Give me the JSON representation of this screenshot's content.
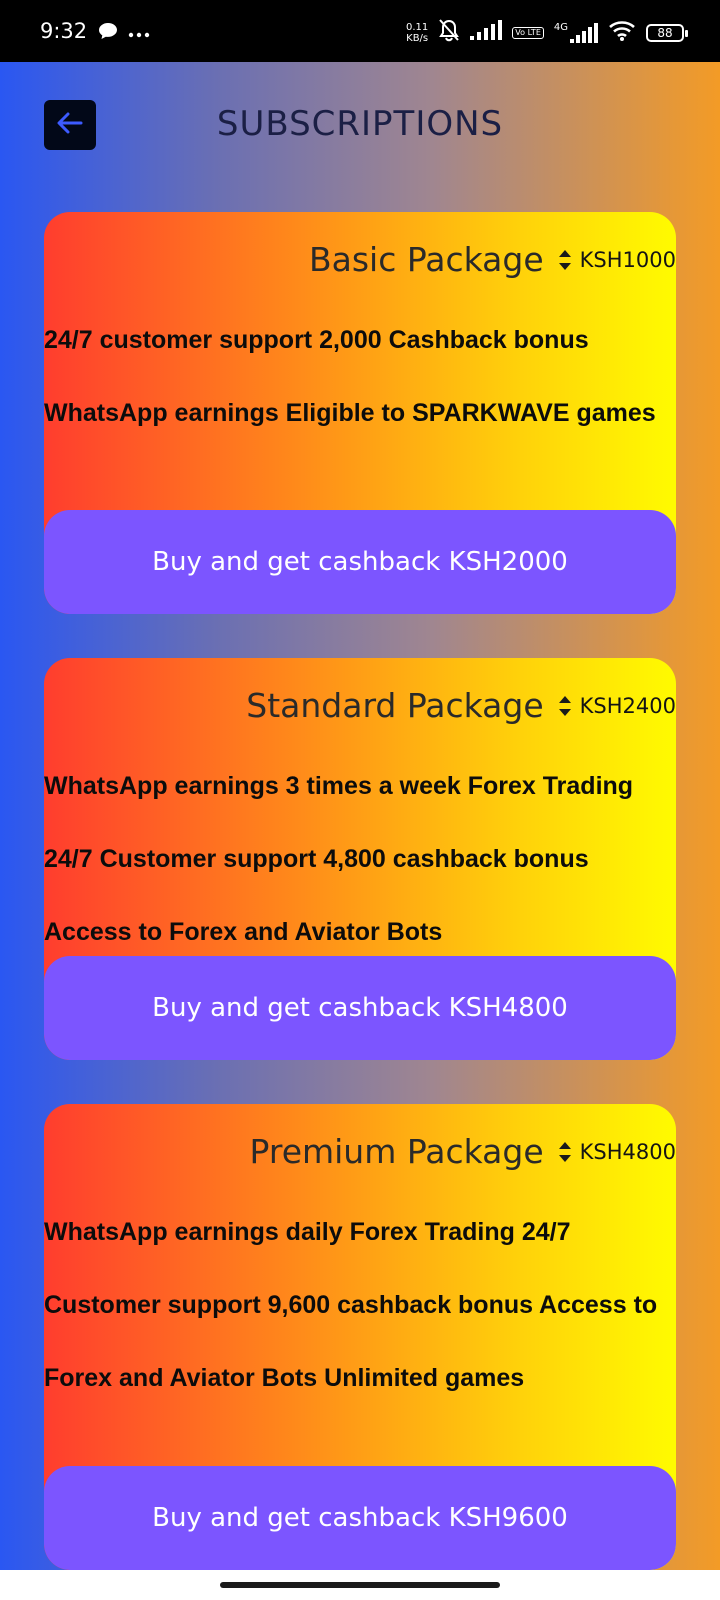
{
  "status_bar": {
    "time": "9:32",
    "net_speed_value": "0.11",
    "net_speed_unit": "KB/s",
    "lte_label": "Vo LTE",
    "network_label": "4G",
    "battery": "88",
    "icons": [
      "chat-bubble-icon",
      "more-dots-icon",
      "bell-muted-icon",
      "signal-icon",
      "signal-4g-icon",
      "wifi-icon",
      "battery-icon"
    ]
  },
  "header": {
    "title": "SUBSCRIPTIONS",
    "back_icon": "arrow-left-icon"
  },
  "colors": {
    "background_start": "#2a57f2",
    "background_end": "#f39b26",
    "card_start": "#ff3d2e",
    "card_end": "#fffb00",
    "button": "#7c55ff",
    "title": "#1b1f45"
  },
  "packages": [
    {
      "name": "Basic Package",
      "price": "KSH1000",
      "features": "24/7 customer support 2,000 Cashback bonus WhatsApp earnings Eligible to SPARKWAVE games",
      "button_label": "Buy and get cashback KSH2000"
    },
    {
      "name": "Standard Package",
      "price": "KSH2400",
      "features": "WhatsApp earnings 3 times a week Forex Trading 24/7 Customer support 4,800 cashback bonus Access to Forex and Aviator Bots",
      "button_label": "Buy and get cashback KSH4800"
    },
    {
      "name": "Premium Package",
      "price": "KSH4800",
      "features": "WhatsApp earnings daily Forex Trading 24/7 Customer support 9,600 cashback bonus Access to Forex and Aviator Bots Unlimited games",
      "button_label": "Buy and get cashback KSH9600"
    }
  ]
}
